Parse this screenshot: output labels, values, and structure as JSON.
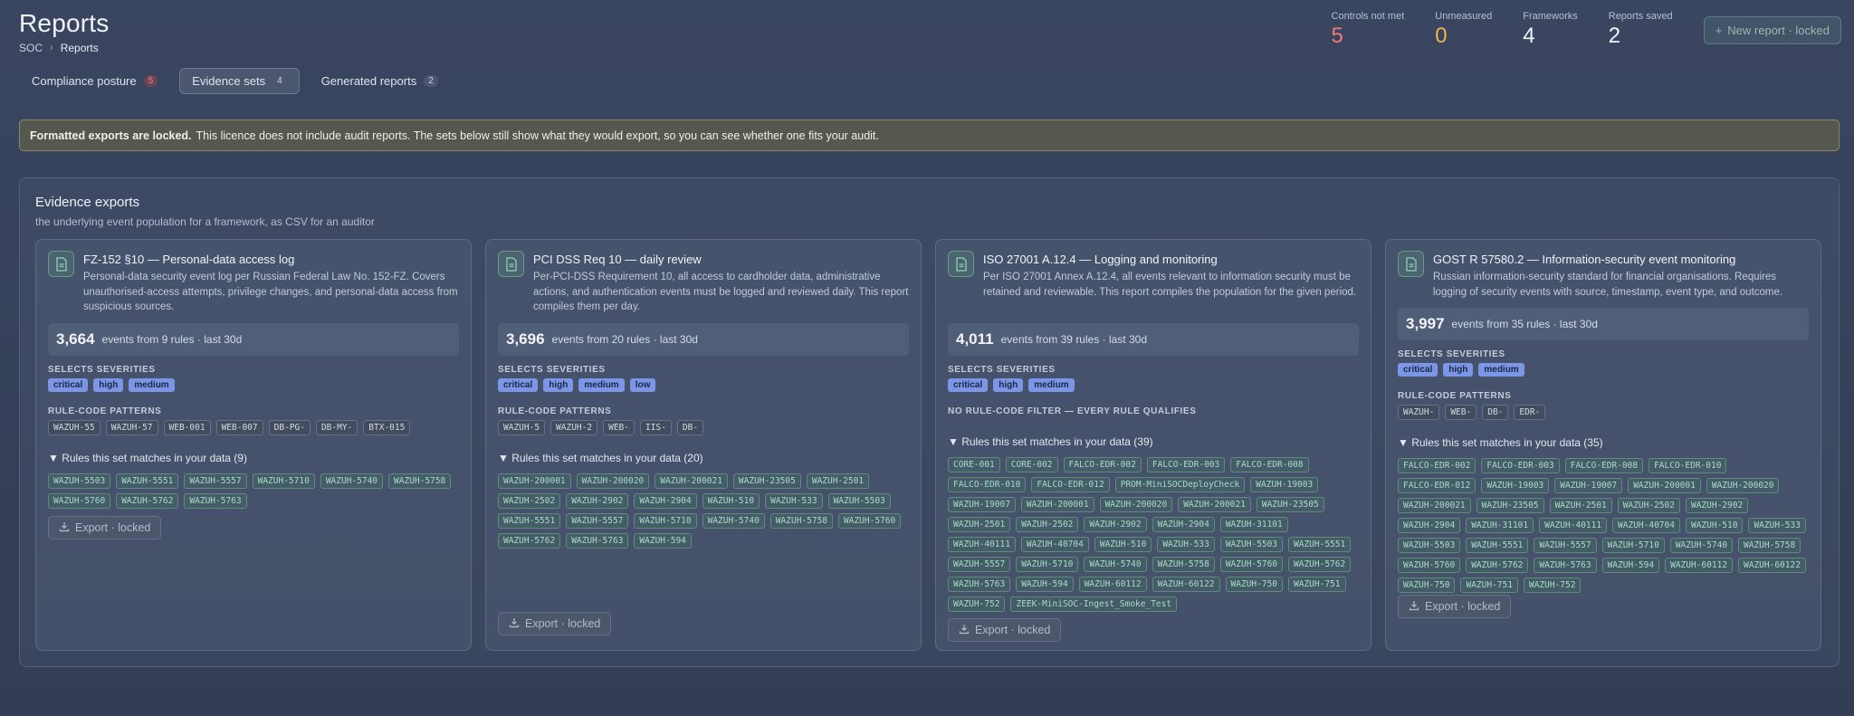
{
  "page": {
    "title": "Reports",
    "breadcrumb": {
      "root": "SOC",
      "current": "Reports"
    }
  },
  "stats": [
    {
      "label": "Controls not met",
      "value": "5",
      "color": "#f07a7a"
    },
    {
      "label": "Unmeasured",
      "value": "0",
      "color": "#f2b34d"
    },
    {
      "label": "Frameworks",
      "value": "4",
      "color": "#f0f3f8"
    },
    {
      "label": "Reports saved",
      "value": "2",
      "color": "#f0f3f8"
    }
  ],
  "new_report_label": "New report · locked",
  "tabs": [
    {
      "label": "Compliance posture",
      "count": "5",
      "active": false
    },
    {
      "label": "Evidence sets",
      "count": "4",
      "active": true
    },
    {
      "label": "Generated reports",
      "count": "2",
      "active": false
    }
  ],
  "banner": {
    "bold": "Formatted exports are locked.",
    "text": "This licence does not include audit reports. The sets below still show what they would export, so you can see whether one fits your audit."
  },
  "evidence": {
    "title": "Evidence exports",
    "subtitle": "the underlying event population for a framework, as CSV for an auditor",
    "severities_label": "SELECTS SEVERITIES",
    "patterns_label": "RULE-CODE PATTERNS",
    "no_filter_label": "NO RULE-CODE FILTER — EVERY RULE QUALIFIES",
    "export_label": "Export · locked",
    "cards": [
      {
        "title": "FZ-152 §10 — Personal-data access log",
        "desc": "Personal-data security event log per Russian Federal Law No. 152-FZ. Covers unauthorised-access attempts, privilege changes, and personal-data access from suspicious sources.",
        "events": "3,664",
        "events_text": "events from 9 rules · last 30d",
        "severities": [
          "critical",
          "high",
          "medium"
        ],
        "patterns": [
          "WAZUH-55",
          "WAZUH-57",
          "WEB-001",
          "WEB-007",
          "DB-PG-",
          "DB-MY-",
          "BTX-015"
        ],
        "matches_label": "▼ Rules this set matches in your data (9)",
        "rules": [
          "WAZUH-5503",
          "WAZUH-5551",
          "WAZUH-5557",
          "WAZUH-5710",
          "WAZUH-5740",
          "WAZUH-5758",
          "WAZUH-5760",
          "WAZUH-5762",
          "WAZUH-5763"
        ]
      },
      {
        "title": "PCI DSS Req 10 — daily review",
        "desc": "Per-PCI-DSS Requirement 10, all access to cardholder data, administrative actions, and authentication events must be logged and reviewed daily. This report compiles them per day.",
        "events": "3,696",
        "events_text": "events from 20 rules · last 30d",
        "severities": [
          "critical",
          "high",
          "medium",
          "low"
        ],
        "patterns": [
          "WAZUH-5",
          "WAZUH-2",
          "WEB-",
          "IIS-",
          "DB-"
        ],
        "matches_label": "▼ Rules this set matches in your data (20)",
        "rules": [
          "WAZUH-200001",
          "WAZUH-200020",
          "WAZUH-200021",
          "WAZUH-23505",
          "WAZUH-2501",
          "WAZUH-2502",
          "WAZUH-2902",
          "WAZUH-2904",
          "WAZUH-510",
          "WAZUH-533",
          "WAZUH-5503",
          "WAZUH-5551",
          "WAZUH-5557",
          "WAZUH-5710",
          "WAZUH-5740",
          "WAZUH-5758",
          "WAZUH-5760",
          "WAZUH-5762",
          "WAZUH-5763",
          "WAZUH-594"
        ]
      },
      {
        "title": "ISO 27001 A.12.4 — Logging and monitoring",
        "desc": "Per ISO 27001 Annex A.12.4, all events relevant to information security must be retained and reviewable. This report compiles the population for the given period.",
        "events": "4,011",
        "events_text": "events from 39 rules · last 30d",
        "severities": [
          "critical",
          "high",
          "medium"
        ],
        "patterns": [],
        "matches_label": "▼ Rules this set matches in your data (39)",
        "rules": [
          "CORE-001",
          "CORE-002",
          "FALCO-EDR-002",
          "FALCO-EDR-003",
          "FALCO-EDR-008",
          "FALCO-EDR-010",
          "FALCO-EDR-012",
          "PROM-MiniSOCDeployCheck",
          "WAZUH-19003",
          "WAZUH-19007",
          "WAZUH-200001",
          "WAZUH-200020",
          "WAZUH-200021",
          "WAZUH-23505",
          "WAZUH-2501",
          "WAZUH-2502",
          "WAZUH-2902",
          "WAZUH-2904",
          "WAZUH-31101",
          "WAZUH-40111",
          "WAZUH-40704",
          "WAZUH-510",
          "WAZUH-533",
          "WAZUH-5503",
          "WAZUH-5551",
          "WAZUH-5557",
          "WAZUH-5710",
          "WAZUH-5740",
          "WAZUH-5758",
          "WAZUH-5760",
          "WAZUH-5762",
          "WAZUH-5763",
          "WAZUH-594",
          "WAZUH-60112",
          "WAZUH-60122",
          "WAZUH-750",
          "WAZUH-751",
          "WAZUH-752",
          "ZEEK-MiniSOC-Ingest_Smoke_Test"
        ]
      },
      {
        "title": "GOST R 57580.2 — Information-security event monitoring",
        "desc": "Russian information-security standard for financial organisations. Requires logging of security events with source, timestamp, event type, and outcome.",
        "events": "3,997",
        "events_text": "events from 35 rules · last 30d",
        "severities": [
          "critical",
          "high",
          "medium"
        ],
        "patterns": [
          "WAZUH-",
          "WEB-",
          "DB-",
          "EDR-"
        ],
        "matches_label": "▼ Rules this set matches in your data (35)",
        "rules": [
          "FALCO-EDR-002",
          "FALCO-EDR-003",
          "FALCO-EDR-008",
          "FALCO-EDR-010",
          "FALCO-EDR-012",
          "WAZUH-19003",
          "WAZUH-19007",
          "WAZUH-200001",
          "WAZUH-200020",
          "WAZUH-200021",
          "WAZUH-23505",
          "WAZUH-2501",
          "WAZUH-2502",
          "WAZUH-2902",
          "WAZUH-2904",
          "WAZUH-31101",
          "WAZUH-40111",
          "WAZUH-40704",
          "WAZUH-510",
          "WAZUH-533",
          "WAZUH-5503",
          "WAZUH-5551",
          "WAZUH-5557",
          "WAZUH-5710",
          "WAZUH-5740",
          "WAZUH-5758",
          "WAZUH-5760",
          "WAZUH-5762",
          "WAZUH-5763",
          "WAZUH-594",
          "WAZUH-60112",
          "WAZUH-60122",
          "WAZUH-750",
          "WAZUH-751",
          "WAZUH-752"
        ]
      }
    ]
  }
}
